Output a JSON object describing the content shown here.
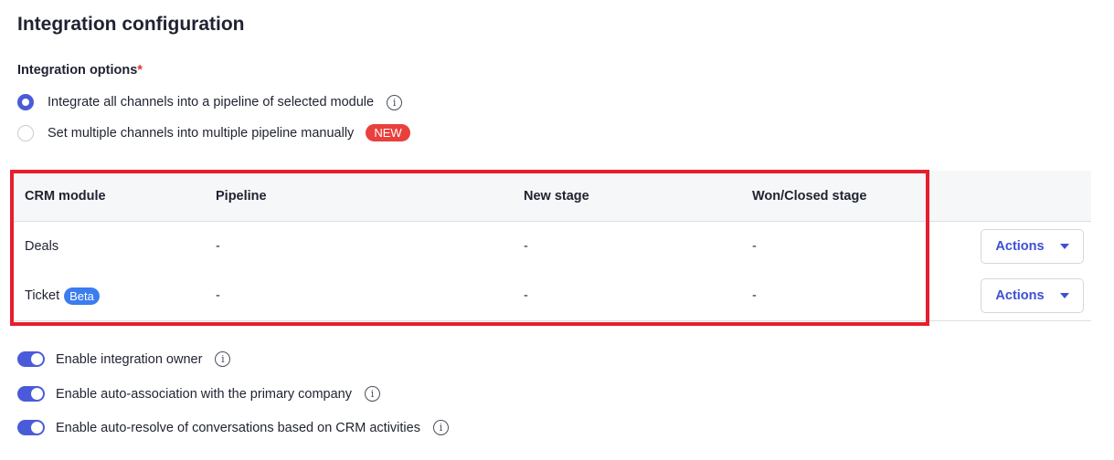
{
  "page": {
    "title": "Integration configuration"
  },
  "options": {
    "label": "Integration options",
    "required_mark": "*",
    "radios": [
      {
        "label": "Integrate all channels into a pipeline of selected module",
        "selected": true,
        "has_info": true
      },
      {
        "label": "Set multiple channels into multiple pipeline manually",
        "selected": false,
        "badge": "NEW"
      }
    ]
  },
  "table": {
    "headers": [
      "CRM module",
      "Pipeline",
      "New stage",
      "Won/Closed stage"
    ],
    "rows": [
      {
        "module": "Deals",
        "badge": "",
        "pipeline": "-",
        "new_stage": "-",
        "won_stage": "-",
        "action": "Actions"
      },
      {
        "module": "Ticket",
        "badge": "Beta",
        "pipeline": "-",
        "new_stage": "-",
        "won_stage": "-",
        "action": "Actions"
      }
    ]
  },
  "toggles": [
    {
      "label": "Enable integration owner",
      "on": true
    },
    {
      "label": "Enable auto-association with the primary company",
      "on": true
    },
    {
      "label": "Enable auto-resolve of conversations based on CRM activities",
      "on": true
    }
  ],
  "icons": {
    "info": "info-icon",
    "caret": "chevron-down-icon"
  },
  "colors": {
    "accent": "#4a5bd9",
    "new_badge": "#e9403d",
    "beta_badge": "#3b7cf0",
    "highlight": "#e81e2c"
  }
}
